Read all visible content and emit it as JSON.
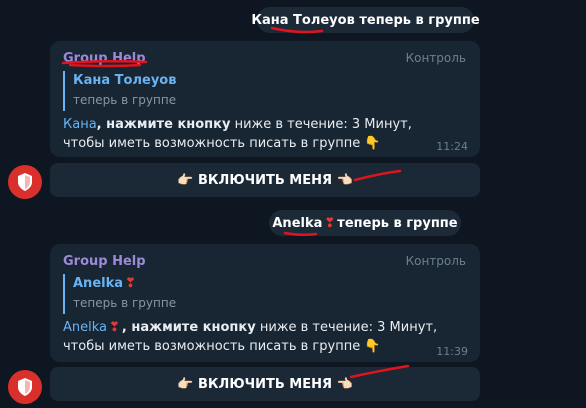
{
  "messages": [
    {
      "service_name": "Кана Толеуов",
      "service_text": "теперь в группе",
      "sender": "Group Help",
      "badge": "Контроль",
      "reply_name": "Кана Толеуов",
      "reply_text": "теперь в группе",
      "mention": "Кана",
      "bold_text": ", нажмите кнопку",
      "body_text": " ниже в течение: 3 Минут, чтобы иметь возможность писать в группе 👇",
      "time": "11:24",
      "button_label": "👉🏻 ВКЛЮЧИТЬ МЕНЯ 👈🏻"
    },
    {
      "service_name": "Anelka",
      "service_text": "теперь в группе",
      "sender": "Group Help",
      "badge": "Контроль",
      "reply_name": "Anelka",
      "reply_text": "теперь в группе",
      "mention": "Anelka",
      "bold_text": ", нажмите кнопку",
      "body_text": " ниже в течение: 3 Минут, чтобы иметь возможность писать в группе 👇",
      "time": "11:39",
      "button_label": "👉🏻 ВКЛЮЧИТЬ МЕНЯ 👈🏻"
    }
  ],
  "heart_icon": "❣",
  "colors": {
    "background": "#0e1621",
    "bubble": "#182533",
    "sender": "#9e89d8",
    "link": "#6ab3f3",
    "avatar": "#d9302b",
    "annotation": "#e0141e"
  },
  "icons": [
    "shield-icon",
    "heart-exclamation-icon",
    "pointing-right-emoji",
    "pointing-left-emoji",
    "pointing-down-emoji"
  ]
}
